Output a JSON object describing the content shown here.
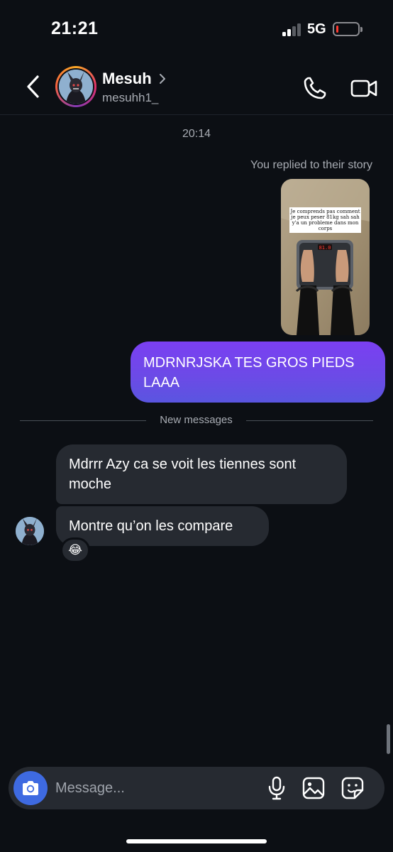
{
  "status_bar": {
    "time": "21:21",
    "network": "5G",
    "battery_level": 0.1,
    "battery_color": "#ff3b30"
  },
  "header": {
    "contact_name": "Mesuh",
    "username": "mesuhh1_",
    "icons": [
      "chevron-left-icon",
      "chevron-right-icon",
      "phone-icon",
      "video-camera-icon"
    ]
  },
  "conversation": {
    "timestamp": "20:14",
    "story_reply_label": "You replied to their story",
    "story": {
      "caption": "Je comprends pas comment je peux peser 81kg sah sah y'a un probleme dans mon corps",
      "scale_reading": "81.0"
    },
    "sent_message": "MDRNRJSKA TES GROS PIEDS LAAA",
    "new_messages_label": "New messages",
    "received_messages": [
      {
        "text": "Mdrrr Azy ca se voit les tiennes sont moche"
      },
      {
        "text": "Montre qu’on les compare"
      }
    ],
    "reaction": "😂"
  },
  "composer": {
    "placeholder": "Message...",
    "icons": [
      "camera-icon",
      "microphone-icon",
      "gallery-icon",
      "sticker-icon"
    ]
  },
  "colors": {
    "background": "#0c0f14",
    "sent_bubble": "#6b4be6",
    "received_bubble": "#262a31",
    "camera_button": "#3e6ae1",
    "secondary_text": "#a8acb3"
  }
}
